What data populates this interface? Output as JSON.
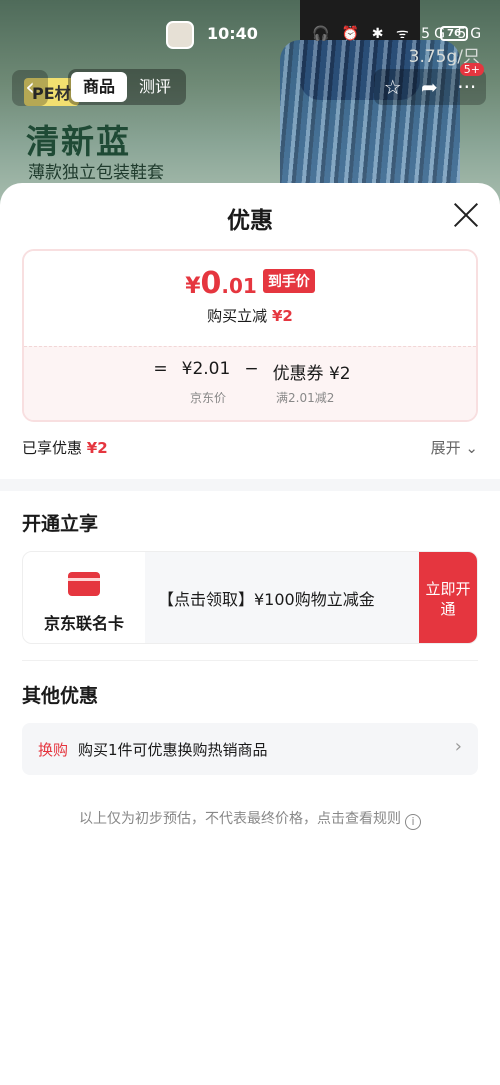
{
  "status": {
    "time": "10:40",
    "icons": "🎧 ⏰ ✱ ᯤ 5G 5G",
    "battery": "76"
  },
  "banner": {
    "title": "清新蓝",
    "subtitle": "薄款独立包装鞋套",
    "badge": "PE材",
    "price_hint": "3.75g/只"
  },
  "nav": {
    "tabs": [
      "商品",
      "测评"
    ],
    "cart_badge": "5+",
    "icons": [
      "back-icon",
      "star-icon",
      "share-icon",
      "more-icon"
    ]
  },
  "sheet": {
    "title": "优惠",
    "final_price": {
      "yen": "¥",
      "integer": "0",
      "decimal": ".01",
      "tag": "到手价"
    },
    "reduce_label": "购买立减",
    "reduce_value": "¥2",
    "formula": {
      "eq": "=",
      "price": "¥2.01",
      "minus": "−",
      "coupon": "优惠券 ¥2"
    },
    "formula_labels": {
      "price": "京东价",
      "coupon": "满2.01减2"
    },
    "enjoyed_label": "已享优惠",
    "enjoyed_value": "¥2",
    "expand": "展开 ⌄"
  },
  "open_section": {
    "title": "开通立享",
    "card_name": "京东联名卡",
    "offer": "【点击领取】¥100购物立减金",
    "button": "立即开通"
  },
  "other_section": {
    "title": "其他优惠",
    "swap_label": "换购",
    "swap_text": "购买1件可优惠换购热销商品",
    "chevron": "›"
  },
  "footer": {
    "note": "以上仅为初步预估，不代表最终价格，点击查看规则",
    "info": "i"
  },
  "colors": {
    "accent": "#e5363f",
    "card_bg": "#fdf4f4",
    "muted": "#888888"
  }
}
